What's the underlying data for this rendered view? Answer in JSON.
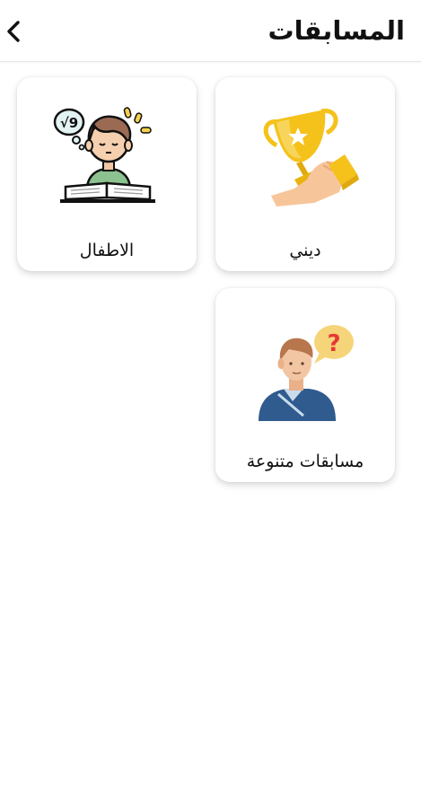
{
  "header": {
    "title": "المسابقات",
    "back_icon": "chevron-left-icon"
  },
  "categories": [
    {
      "label": "ديني",
      "icon": "trophy-icon"
    },
    {
      "label": "الاطفال",
      "icon": "student-reading-icon"
    },
    {
      "label": "مسابقات متنوعة",
      "icon": "person-question-icon"
    }
  ],
  "colors": {
    "background": "#ffffff",
    "title_text": "#111111",
    "trophy_gold": "#f4c21b",
    "shirt_blue": "#2f5b8e",
    "question_bubble": "#f6d57a",
    "question_mark": "#e53935"
  }
}
